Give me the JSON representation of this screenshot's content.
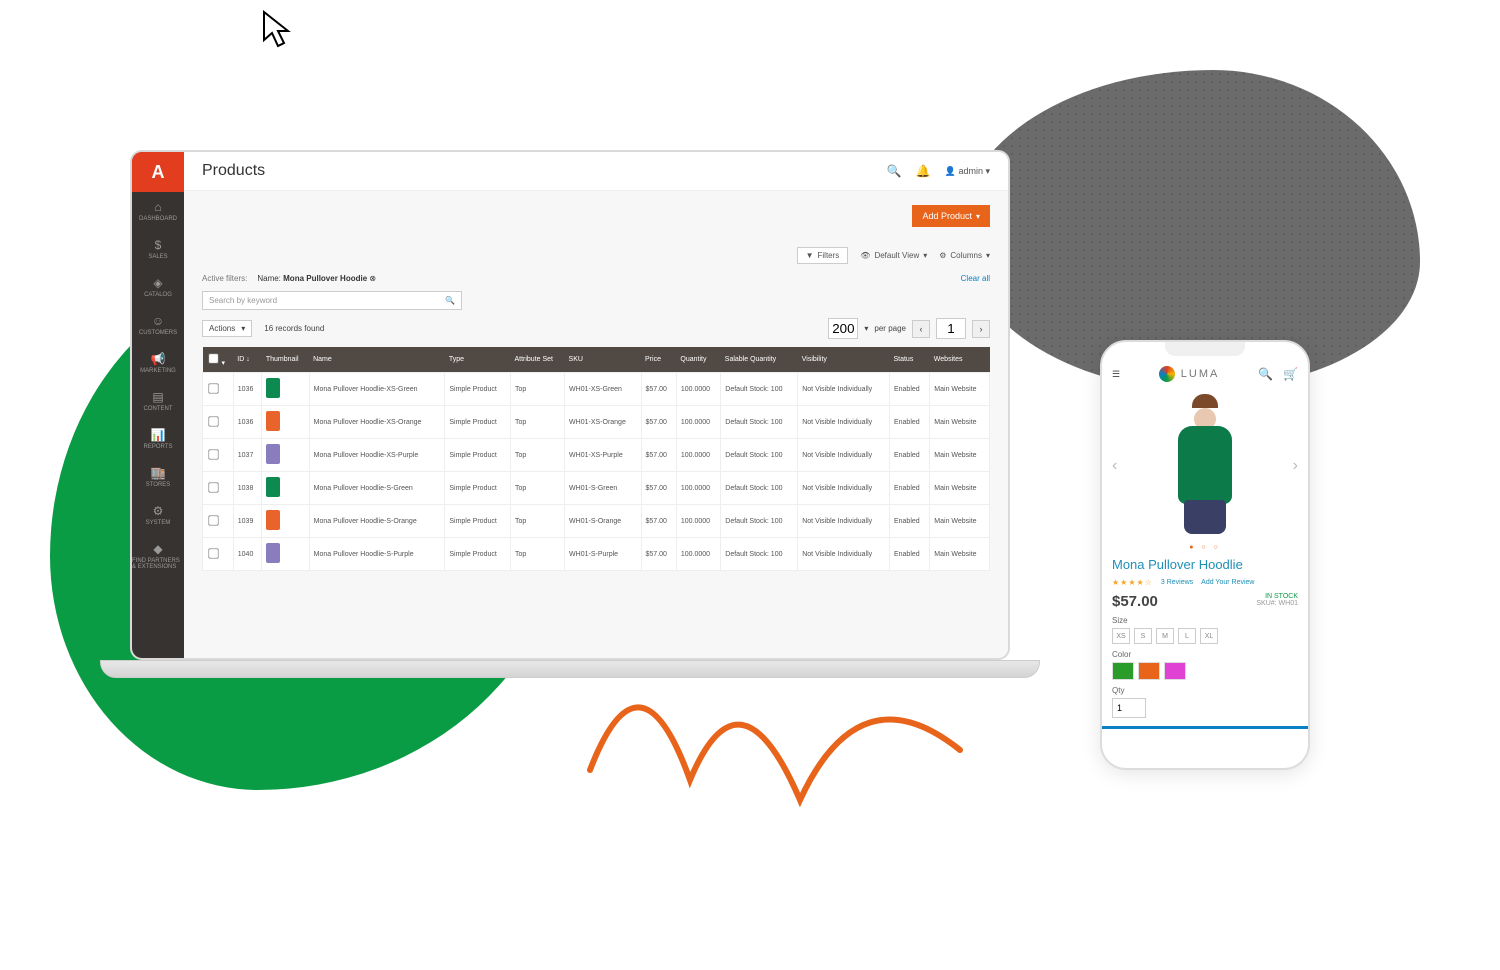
{
  "admin": {
    "page_title": "Products",
    "user_label": "admin ▾",
    "sidebar": {
      "items": [
        {
          "label": "DASHBOARD"
        },
        {
          "label": "SALES"
        },
        {
          "label": "CATALOG"
        },
        {
          "label": "CUSTOMERS"
        },
        {
          "label": "MARKETING"
        },
        {
          "label": "CONTENT"
        },
        {
          "label": "REPORTS"
        },
        {
          "label": "STORES"
        },
        {
          "label": "SYSTEM"
        },
        {
          "label": "FIND PARTNERS & EXTENSIONS"
        }
      ]
    },
    "add_button": "Add Product",
    "toolbar": {
      "filters": "Filters",
      "default_view": "Default View",
      "columns": "Columns"
    },
    "filter": {
      "active_label": "Active filters:",
      "name_prefix": "Name:",
      "name_value": "Mona Pullover Hoodie",
      "clear": "Clear all"
    },
    "search_placeholder": "Search by keyword",
    "actions_label": "Actions",
    "records_found": "16 records found",
    "per_page_value": "200",
    "per_page_label": "per page",
    "page_current": "1",
    "columns_hdr": [
      "",
      "ID ↓",
      "Thumbnail",
      "Name",
      "Type",
      "Attribute Set",
      "SKU",
      "Price",
      "Quantity",
      "Salable Quantity",
      "Visibility",
      "Status",
      "Websites"
    ],
    "rows": [
      {
        "id": "1036",
        "thumb": "green",
        "name": "Mona Pullover Hoodlie-XS-Green",
        "type": "Simple Product",
        "attr": "Top",
        "sku": "WH01-XS-Green",
        "price": "$57.00",
        "qty": "100.0000",
        "sal": "Default Stock: 100",
        "vis": "Not Visible Individually",
        "status": "Enabled",
        "web": "Main Website"
      },
      {
        "id": "1036",
        "thumb": "orange",
        "name": "Mona Pullover Hoodlie-XS-Orange",
        "type": "Simple Product",
        "attr": "Top",
        "sku": "WH01-XS-Orange",
        "price": "$57.00",
        "qty": "100.0000",
        "sal": "Default Stock: 100",
        "vis": "Not Visible Individually",
        "status": "Enabled",
        "web": "Main Website"
      },
      {
        "id": "1037",
        "thumb": "purple",
        "name": "Mona Pullover Hoodlie-XS-Purple",
        "type": "Simple Product",
        "attr": "Top",
        "sku": "WH01-XS-Purple",
        "price": "$57.00",
        "qty": "100.0000",
        "sal": "Default Stock: 100",
        "vis": "Not Visible Individually",
        "status": "Enabled",
        "web": "Main Website"
      },
      {
        "id": "1038",
        "thumb": "green",
        "name": "Mona Pullover Hoodlie-S-Green",
        "type": "Simple Product",
        "attr": "Top",
        "sku": "WH01-S-Green",
        "price": "$57.00",
        "qty": "100.0000",
        "sal": "Default Stock: 100",
        "vis": "Not Visible Individually",
        "status": "Enabled",
        "web": "Main Website"
      },
      {
        "id": "1039",
        "thumb": "orange",
        "name": "Mona Pullover Hoodlie-S-Orange",
        "type": "Simple Product",
        "attr": "Top",
        "sku": "WH01-S-Orange",
        "price": "$57.00",
        "qty": "100.0000",
        "sal": "Default Stock: 100",
        "vis": "Not Visible Individually",
        "status": "Enabled",
        "web": "Main Website"
      },
      {
        "id": "1040",
        "thumb": "purple",
        "name": "Mona Pullover Hoodlie-S-Purple",
        "type": "Simple Product",
        "attr": "Top",
        "sku": "WH01-S-Purple",
        "price": "$57.00",
        "qty": "100.0000",
        "sal": "Default Stock: 100",
        "vis": "Not Visible Individually",
        "status": "Enabled",
        "web": "Main Website"
      }
    ]
  },
  "store": {
    "brand": "LUMA",
    "product_name": "Mona Pullover Hoodlie",
    "reviews_count": "3 Reviews",
    "add_review": "Add Your Review",
    "price": "$57.00",
    "stock_status": "IN STOCK",
    "sku_label": "SKU#:",
    "sku_value": "WH01",
    "size_label": "Size",
    "sizes": [
      "XS",
      "S",
      "M",
      "L",
      "XL"
    ],
    "color_label": "Color",
    "qty_label": "Qty",
    "qty_value": "1",
    "dots": "● ○ ○"
  }
}
